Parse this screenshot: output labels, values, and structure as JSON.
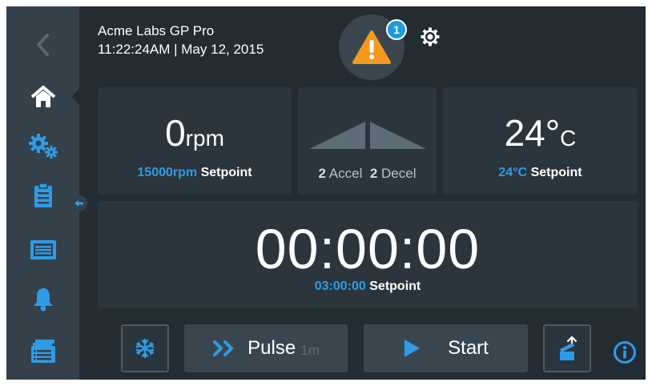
{
  "header": {
    "app_name": "Acme Labs GP Pro",
    "datetime": "11:22:24AM | May 12, 2015",
    "alert_count": "1"
  },
  "sidebar": {
    "items": [
      {
        "icon": "back-chevron-icon"
      },
      {
        "icon": "home-icon",
        "active": true
      },
      {
        "icon": "gears-icon"
      },
      {
        "icon": "clipboard-icon"
      },
      {
        "icon": "rotor-icon"
      },
      {
        "icon": "bell-icon"
      },
      {
        "icon": "programs-icon"
      }
    ]
  },
  "speed": {
    "value": "0",
    "unit": "rpm",
    "setpoint_value": "15000rpm",
    "setpoint_label": "Setpoint"
  },
  "accel": {
    "accel_value": "2",
    "accel_label": "Accel",
    "decel_value": "2",
    "decel_label": "Decel"
  },
  "temperature": {
    "value": "24°",
    "unit": "C",
    "setpoint_value": "24°C",
    "setpoint_label": "Setpoint"
  },
  "timer": {
    "value": "00:00:00",
    "setpoint_value": "03:00:00",
    "setpoint_label": "Setpoint"
  },
  "controls": {
    "pulse_label": "Pulse",
    "pulse_time": "1m",
    "start_label": "Start"
  },
  "colors": {
    "background": "#232c33",
    "sidebar": "#34404a",
    "accent_blue": "#2f9be6",
    "warning_orange": "#f39a1e"
  }
}
